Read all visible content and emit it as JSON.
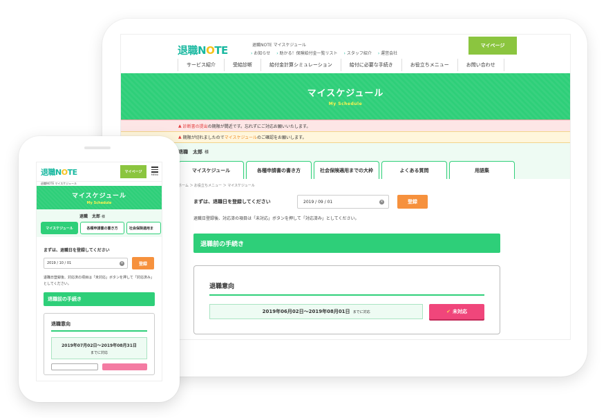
{
  "brand": {
    "logo_main": "退職N",
    "logo_o": "O",
    "logo_rest": "TE"
  },
  "tablet": {
    "site_sub": "退職NOTE マイスケジュール",
    "toplinks": [
      "お知らせ",
      "助かる！保険給付金一覧リスト",
      "スタッフ紹介",
      "運営会社"
    ],
    "mypage": "マイページ",
    "nav": [
      "サービス紹介",
      "受給診断",
      "給付金計算シミュレーション",
      "給付に必要な手続き",
      "お役立ちメニュー",
      "お問い合わせ"
    ],
    "hero_title": "マイスケジュール",
    "hero_sub": "My Schedule",
    "alert1_icon": "▲",
    "alert1_hl": "診断書の提出",
    "alert1_text": "の期限が間近です。忘れずにご対応お願いいたします。",
    "alert2_icon": "▲",
    "alert2_pre": "期限が切れましたので",
    "alert2_hl": "マイスケジュール",
    "alert2_post": "のご確認をお願いします。",
    "username": "退職　太郎",
    "username_suffix": "様",
    "tabs": [
      "マイスケジュール",
      "各種申請書の書き方",
      "社会保険適用までの大枠",
      "よくある質問",
      "用語集"
    ],
    "breadcrumb": "ホーム ＞ お役立ちメニュー ＞ マイスケジュール",
    "register_label": "まずは、退職日を登録してください",
    "date_value": "2019 / 09 / 01",
    "register_button": "登録",
    "note": "退職日登録後、対応済の項目は「未対応」ボタンを押して「対応済み」としてください。",
    "section": "退職前の手続き",
    "card_title": "退職意向",
    "period": "2019年06月02日～2019年08月01日",
    "period_suffix": "までに対応",
    "undone_check": "✔",
    "undone": "未対応"
  },
  "phone": {
    "mypage": "マイページ",
    "menu_label": "MENU",
    "site_sub": "退職NOTE マイスケジュール",
    "hero_title": "マイスケジュール",
    "hero_sub": "My Schedule",
    "username": "退職　太郎",
    "username_suffix": "様",
    "tabs": [
      "マイスケジュール",
      "各種申請書の書き方",
      "社会保険適用ま"
    ],
    "register_label": "まずは、退職日を登録してください",
    "date_value": "2019 / 10 / 01",
    "register_button": "登録",
    "note": "退職日登録後、対応済の項目は「未対応」ボタンを押して「対応済み」としてください。",
    "section": "退職前の手続き",
    "card_title": "退職意向",
    "period": "2019年07月02日～2019年08月31日",
    "period_suffix": "までに対応"
  },
  "colors": {
    "accent_green": "#2ecf79",
    "logo_teal": "#19b8a0",
    "mypage_green": "#8bc53f",
    "orange": "#f6913d",
    "pink": "#f0467b"
  }
}
